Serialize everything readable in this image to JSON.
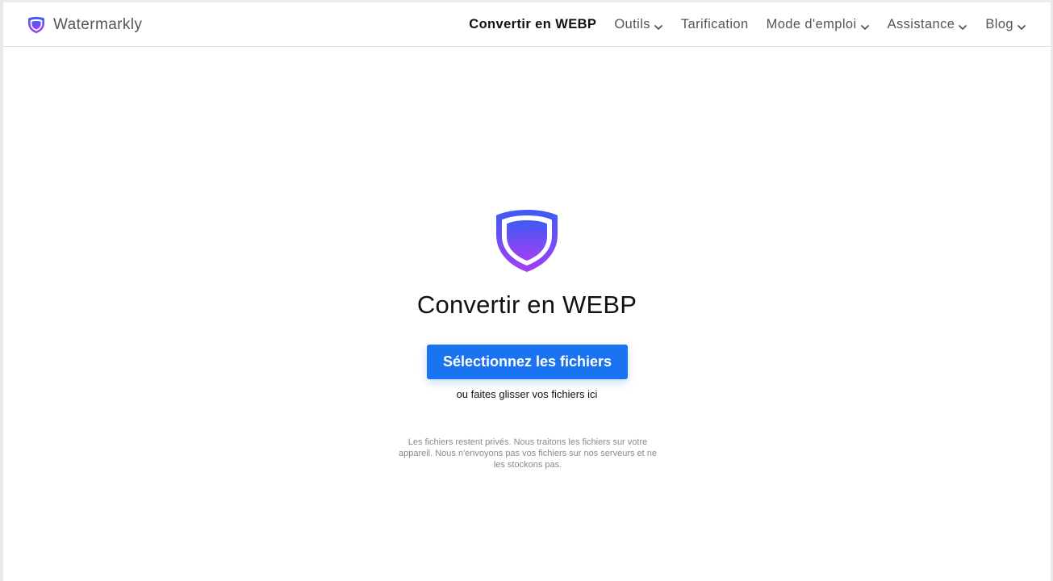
{
  "header": {
    "brand_name": "Watermarkly",
    "nav": [
      {
        "label": "Convertir en WEBP",
        "active": true,
        "dropdown": false
      },
      {
        "label": "Outils",
        "active": false,
        "dropdown": true
      },
      {
        "label": "Tarification",
        "active": false,
        "dropdown": false
      },
      {
        "label": "Mode d'emploi",
        "active": false,
        "dropdown": true
      },
      {
        "label": "Assistance",
        "active": false,
        "dropdown": true
      },
      {
        "label": "Blog",
        "active": false,
        "dropdown": true
      }
    ]
  },
  "main": {
    "title": "Convertir en WEBP",
    "select_button_label": "Sélectionnez les fichiers",
    "drop_hint": "ou faites glisser vos fichiers ici",
    "privacy_note": "Les fichiers restent privés. Nous traitons les fichiers sur votre appareil. Nous n'envoyons pas vos fichiers sur nos serveurs et ne les stockons pas."
  },
  "icons": {
    "logo": "shield-icon",
    "dropdown": "chevron-down-icon"
  },
  "colors": {
    "accent_blue": "#1a73f0",
    "shield_gradient_top": "#3d5cf5",
    "shield_gradient_bottom": "#a43ef5"
  }
}
